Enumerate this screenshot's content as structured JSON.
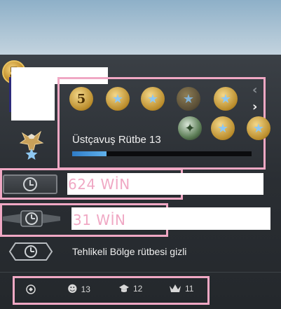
{
  "profile": {
    "level_badge": "5",
    "rank_title": "Üstçavuş Rütbe 13",
    "rank_progress": 0.19
  },
  "medals": {
    "icons": [
      "service-medal-5",
      "star-medal",
      "star-medal",
      "star-medal",
      "star-medal",
      "star-medal",
      "coin-medal",
      "star-medal",
      "star-medal"
    ],
    "numbered_badge": "5"
  },
  "nav": {
    "prev_icon": "‹",
    "next_icon": "›"
  },
  "competitive": {
    "wins_text": "624 WİN"
  },
  "wingman": {
    "wins_text": "31 WİN"
  },
  "danger_zone": {
    "status_text": "Tehlikeli Bölge rütbesi gizli"
  },
  "commendations": {
    "friendly_count": "13",
    "teacher_count": "12",
    "leader_count": "11"
  },
  "colors": {
    "highlight": "#f0a8c4",
    "progress_fill": "#3f93da",
    "medal_star": "#8fc8f2"
  }
}
